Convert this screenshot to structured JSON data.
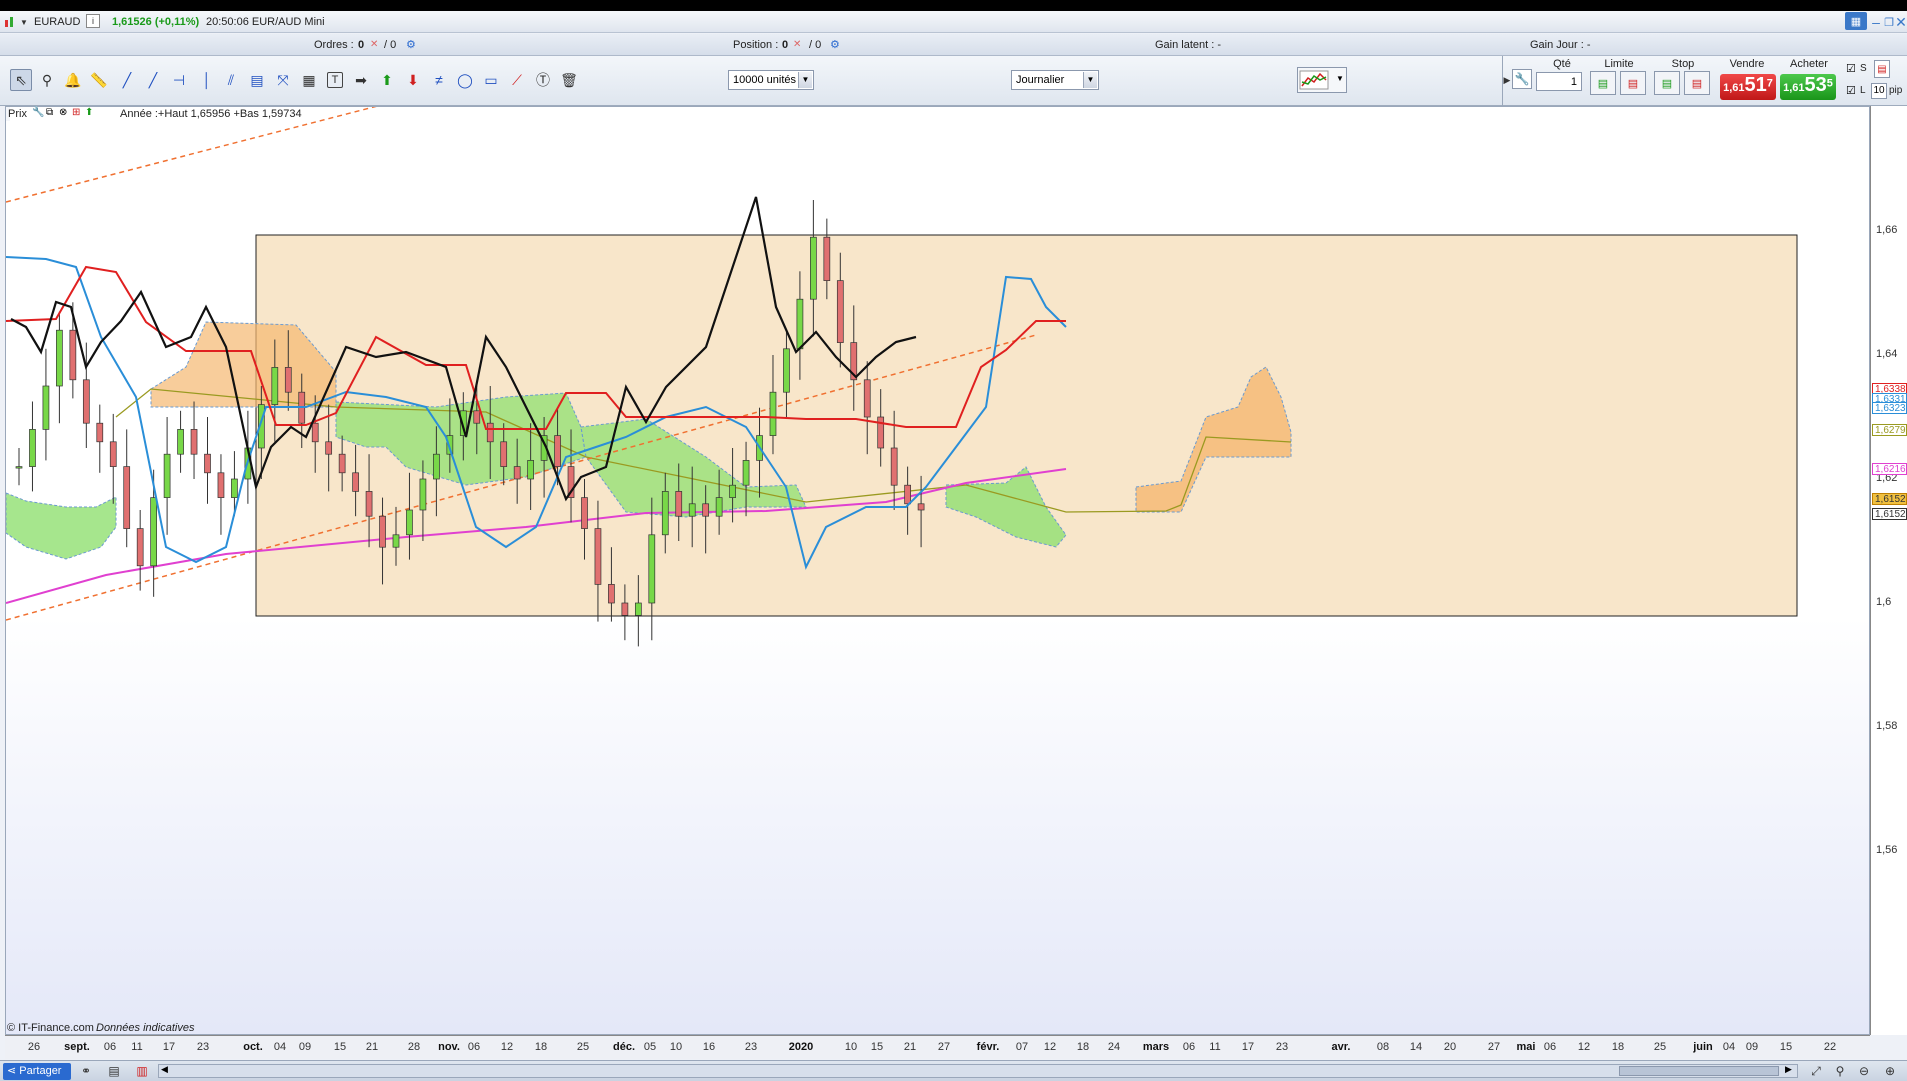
{
  "titlebar": {
    "symbol": "EURAUD",
    "price_change": "1,61526 (+0,11%)",
    "time_name": "20:50:06 EUR/AUD Mini"
  },
  "orders_bar": {
    "orders_label": "Ordres :",
    "orders_value": "0",
    "orders_sep": "/ 0",
    "position_label": "Position :",
    "position_value": "0",
    "position_sep": "/ 0",
    "gain_latent": "Gain latent : -",
    "gain_jour": "Gain Jour : -"
  },
  "toolbar": {
    "quantity_select": "10000 unités",
    "period_select": "Journalier",
    "qty_header": "Qté",
    "qty_value": "1",
    "limit_header": "Limite",
    "stop_header": "Stop",
    "sell_header": "Vendre",
    "buy_header": "Acheter",
    "sell_small": "1,61",
    "sell_big": "51",
    "sell_sup": "7",
    "buy_small": "1,61",
    "buy_big": "53",
    "buy_sup": "5",
    "s_label": "S",
    "l_label": "L",
    "pips_value": "10",
    "pips_label": "pip"
  },
  "chart_header": {
    "prix_label": "Prix",
    "info": "Année :+Haut 1,65956 +Bas 1,59734"
  },
  "footer": {
    "source": "© IT-Finance.com",
    "note": "Données indicatives"
  },
  "bottom": {
    "share_label": "Partager"
  },
  "y_axis": {
    "ticks": [
      "1,66",
      "1,64",
      "1,62",
      "1,6",
      "1,58",
      "1,56"
    ],
    "tags": [
      {
        "text": "1,6338",
        "color": "#e02020"
      },
      {
        "text": "1,6331",
        "color": "#2a8ed8"
      },
      {
        "text": "1,6323",
        "color": "#2a8ed8"
      },
      {
        "text": "1,6279",
        "color": "#9a9a20"
      },
      {
        "text": "1,6216",
        "color": "#e040d0"
      },
      {
        "text": "1,6152",
        "color": "#c08000"
      },
      {
        "text": "1,6152",
        "color": "#333333"
      }
    ]
  },
  "x_axis": {
    "labels": [
      "26",
      "sept.",
      "06",
      "11",
      "17",
      "23",
      "oct.",
      "04",
      "09",
      "15",
      "21",
      "28",
      "nov.",
      "06",
      "12",
      "18",
      "25",
      "déc.",
      "05",
      "10",
      "16",
      "23",
      "2020",
      "10",
      "15",
      "21",
      "27",
      "févr.",
      "07",
      "12",
      "18",
      "24",
      "mars",
      "06",
      "11",
      "17",
      "23",
      "avr.",
      "08",
      "14",
      "20",
      "27",
      "mai",
      "06",
      "12",
      "18",
      "25",
      "juin",
      "04",
      "09",
      "15",
      "22"
    ],
    "bold": [
      "sept.",
      "oct.",
      "nov.",
      "déc.",
      "2020",
      "févr.",
      "mars",
      "avr.",
      "mai",
      "juin"
    ]
  },
  "chart_data": {
    "type": "candlestick",
    "symbol": "EURAUD",
    "timeframe": "Journalier",
    "ylim": [
      1.545,
      1.675
    ],
    "year_high": 1.65956,
    "year_low": 1.59734,
    "last_price": 1.61526,
    "candles_close_sample": [
      1.622,
      1.628,
      1.635,
      1.644,
      1.636,
      1.629,
      1.626,
      1.622,
      1.612,
      1.606,
      1.617,
      1.624,
      1.628,
      1.624,
      1.621,
      1.617,
      1.62,
      1.625,
      1.632,
      1.638,
      1.634,
      1.629,
      1.626,
      1.624,
      1.621,
      1.618,
      1.614,
      1.609,
      1.611,
      1.615,
      1.62,
      1.624,
      1.627,
      1.631,
      1.629,
      1.626,
      1.622,
      1.62,
      1.623,
      1.627,
      1.622,
      1.617,
      1.612,
      1.603,
      1.6,
      1.598,
      1.6,
      1.611,
      1.618,
      1.614,
      1.616,
      1.614,
      1.617,
      1.619,
      1.623,
      1.627,
      1.634,
      1.641,
      1.649,
      1.659,
      1.652,
      1.642,
      1.636,
      1.63,
      1.625,
      1.619,
      1.616,
      1.615
    ],
    "indicators": [
      "Ichimoku cloud",
      "Tenkan (blue)",
      "Kijun (red)",
      "Chikou (black)",
      "MA (magenta)",
      "Trend channel (orange dashed)",
      "Rectangle zone"
    ]
  }
}
